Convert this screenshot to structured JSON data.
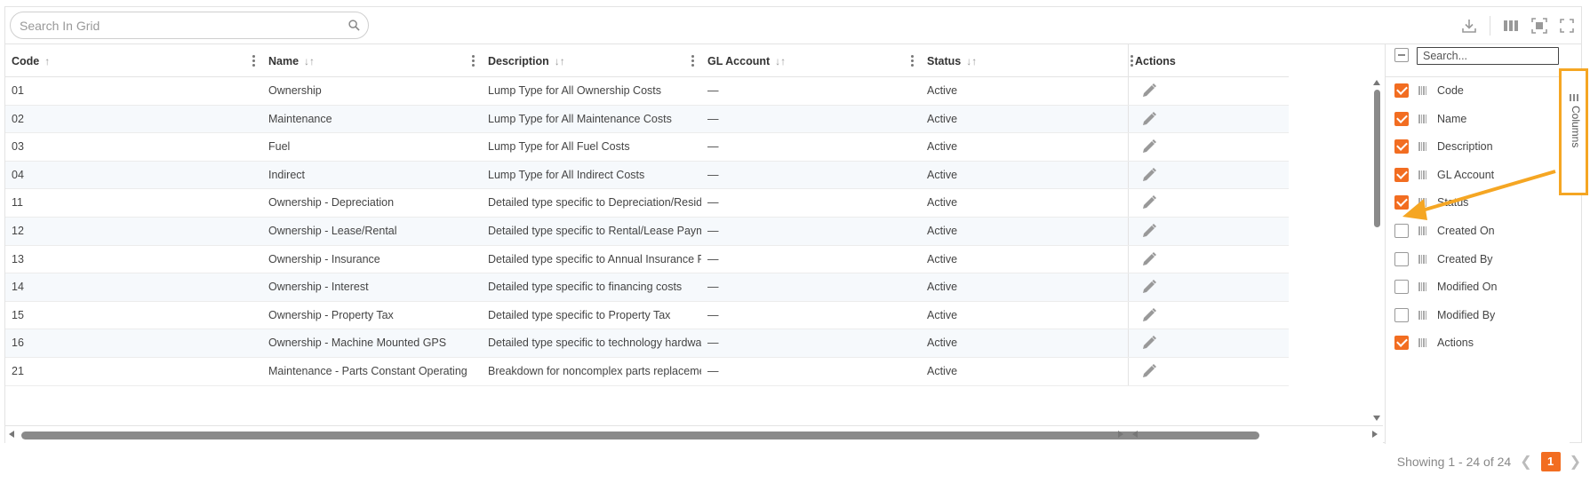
{
  "search": {
    "placeholder": "Search In Grid"
  },
  "toolbar": {
    "icons": [
      "download-icon",
      "columns-icon",
      "fit-screen-icon",
      "fullscreen-icon"
    ]
  },
  "columns": [
    {
      "key": "code",
      "label": "Code",
      "sort": "↑"
    },
    {
      "key": "name",
      "label": "Name",
      "sort": "↓↑"
    },
    {
      "key": "description",
      "label": "Description",
      "sort": "↓↑"
    },
    {
      "key": "gl",
      "label": "GL Account",
      "sort": "↓↑"
    },
    {
      "key": "status",
      "label": "Status",
      "sort": "↓↑"
    },
    {
      "key": "actions",
      "label": "Actions"
    }
  ],
  "rows": [
    {
      "code": "01",
      "name": "Ownership",
      "description": "Lump Type for All Ownership Costs",
      "gl": "—",
      "status": "Active"
    },
    {
      "code": "02",
      "name": "Maintenance",
      "description": "Lump Type for All Maintenance Costs",
      "gl": "—",
      "status": "Active"
    },
    {
      "code": "03",
      "name": "Fuel",
      "description": "Lump Type for All Fuel Costs",
      "gl": "—",
      "status": "Active"
    },
    {
      "code": "04",
      "name": "Indirect",
      "description": "Lump Type for All Indirect Costs",
      "gl": "—",
      "status": "Active"
    },
    {
      "code": "11",
      "name": "Ownership - Depreciation",
      "description": "Detailed type specific to Depreciation/Residual M",
      "gl": "—",
      "status": "Active"
    },
    {
      "code": "12",
      "name": "Ownership - Lease/Rental",
      "description": "Detailed type specific to Rental/Lease Payment C",
      "gl": "—",
      "status": "Active"
    },
    {
      "code": "13",
      "name": "Ownership - Insurance",
      "description": "Detailed type specific to Annual Insurance Premiu",
      "gl": "—",
      "status": "Active"
    },
    {
      "code": "14",
      "name": "Ownership - Interest",
      "description": "Detailed type specific to financing costs",
      "gl": "—",
      "status": "Active"
    },
    {
      "code": "15",
      "name": "Ownership - Property Tax",
      "description": "Detailed type specific to Property Tax",
      "gl": "—",
      "status": "Active"
    },
    {
      "code": "16",
      "name": "Ownership - Machine Mounted GPS",
      "description": "Detailed type specific to technology hardware mo",
      "gl": "—",
      "status": "Active"
    },
    {
      "code": "21",
      "name": "Maintenance - Parts Constant Operating",
      "description": "Breakdown for noncomplex parts replacements t",
      "gl": "—",
      "status": "Active"
    }
  ],
  "column_panel": {
    "search_placeholder": "Search...",
    "items": [
      {
        "label": "Code",
        "checked": true
      },
      {
        "label": "Name",
        "checked": true
      },
      {
        "label": "Description",
        "checked": true
      },
      {
        "label": "GL Account",
        "checked": true
      },
      {
        "label": "Status",
        "checked": true
      },
      {
        "label": "Created On",
        "checked": false
      },
      {
        "label": "Created By",
        "checked": false
      },
      {
        "label": "Modified On",
        "checked": false
      },
      {
        "label": "Modified By",
        "checked": false
      },
      {
        "label": "Actions",
        "checked": true
      }
    ]
  },
  "side_tab": {
    "label": "Columns"
  },
  "footer": {
    "showing": "Showing 1 - 24 of 24",
    "page": "1"
  },
  "colors": {
    "accent": "#f26d21",
    "highlight": "#f5a623"
  }
}
